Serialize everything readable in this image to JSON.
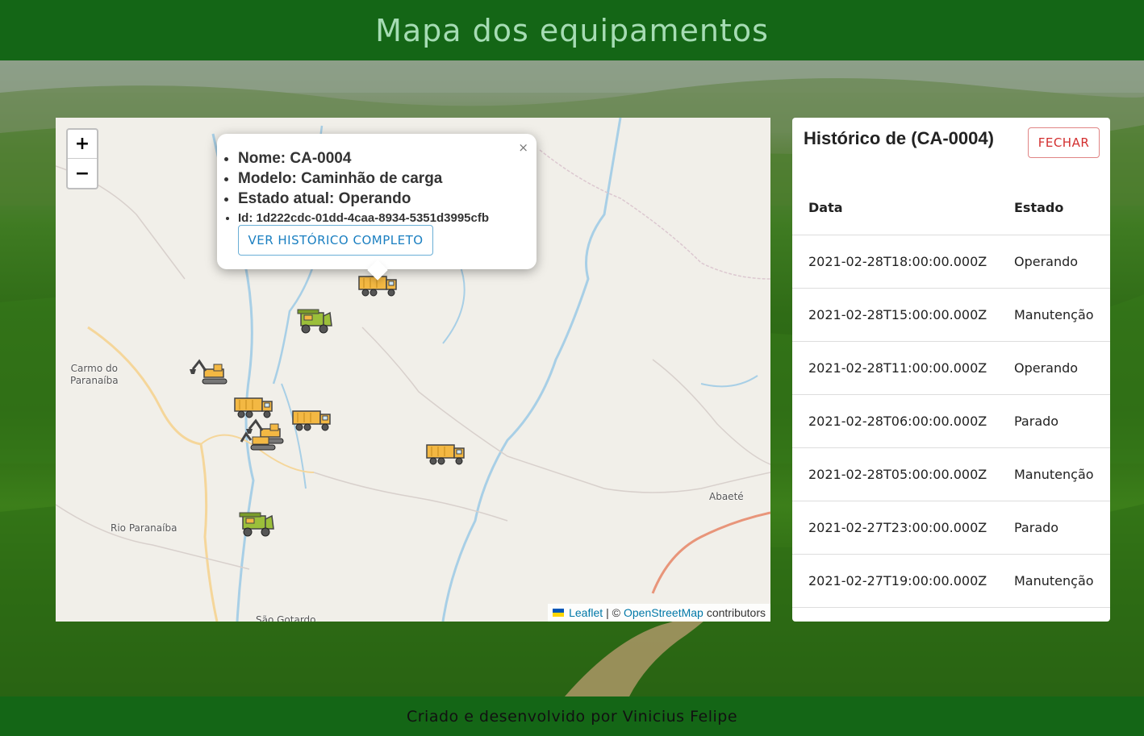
{
  "header": {
    "title": "Mapa dos equipamentos"
  },
  "footer": {
    "credit": "Criado e desenvolvido por Vinicius Felipe"
  },
  "map": {
    "zoom_in": "+",
    "zoom_out": "−",
    "places": {
      "carmo": "Carmo do\nParanaíba",
      "rio": "Rio Paranaíba",
      "abaete": "Abaeté",
      "sao_gotardo": "São Gotardo"
    },
    "popup": {
      "close": "×",
      "nome": "Nome: CA-0004",
      "modelo": "Modelo: Caminhão de carga",
      "estado": "Estado atual: Operando",
      "id": "Id: 1d222cdc-01dd-4caa-8934-5351d3995cfb",
      "button": "VER HISTÓRICO COMPLETO"
    },
    "attribution": {
      "leaflet": "Leaflet",
      "separator": "| ©",
      "osm": "OpenStreetMap",
      "contributors": "contributors"
    },
    "markers": [
      {
        "type": "truck-icon"
      },
      {
        "type": "harvester-icon"
      },
      {
        "type": "excavator-icon"
      },
      {
        "type": "truck-icon"
      },
      {
        "type": "truck-icon"
      },
      {
        "type": "excavator-icon"
      },
      {
        "type": "truck-icon"
      },
      {
        "type": "harvester-icon"
      }
    ]
  },
  "history": {
    "title": "Histórico de (CA-0004)",
    "close_button": "FECHAR",
    "columns": [
      "Data",
      "Estado"
    ],
    "rows": [
      {
        "data": "2021-02-28T18:00:00.000Z",
        "estado": "Operando"
      },
      {
        "data": "2021-02-28T15:00:00.000Z",
        "estado": "Manutenção"
      },
      {
        "data": "2021-02-28T11:00:00.000Z",
        "estado": "Operando"
      },
      {
        "data": "2021-02-28T06:00:00.000Z",
        "estado": "Parado"
      },
      {
        "data": "2021-02-28T05:00:00.000Z",
        "estado": "Manutenção"
      },
      {
        "data": "2021-02-27T23:00:00.000Z",
        "estado": "Parado"
      },
      {
        "data": "2021-02-27T19:00:00.000Z",
        "estado": "Manutenção"
      }
    ]
  },
  "colors": {
    "header_bg": "#146616",
    "header_text": "#a6dcb4",
    "link": "#0078a8",
    "button_blue": "#1a7fc1",
    "button_red": "#d32f2f"
  }
}
